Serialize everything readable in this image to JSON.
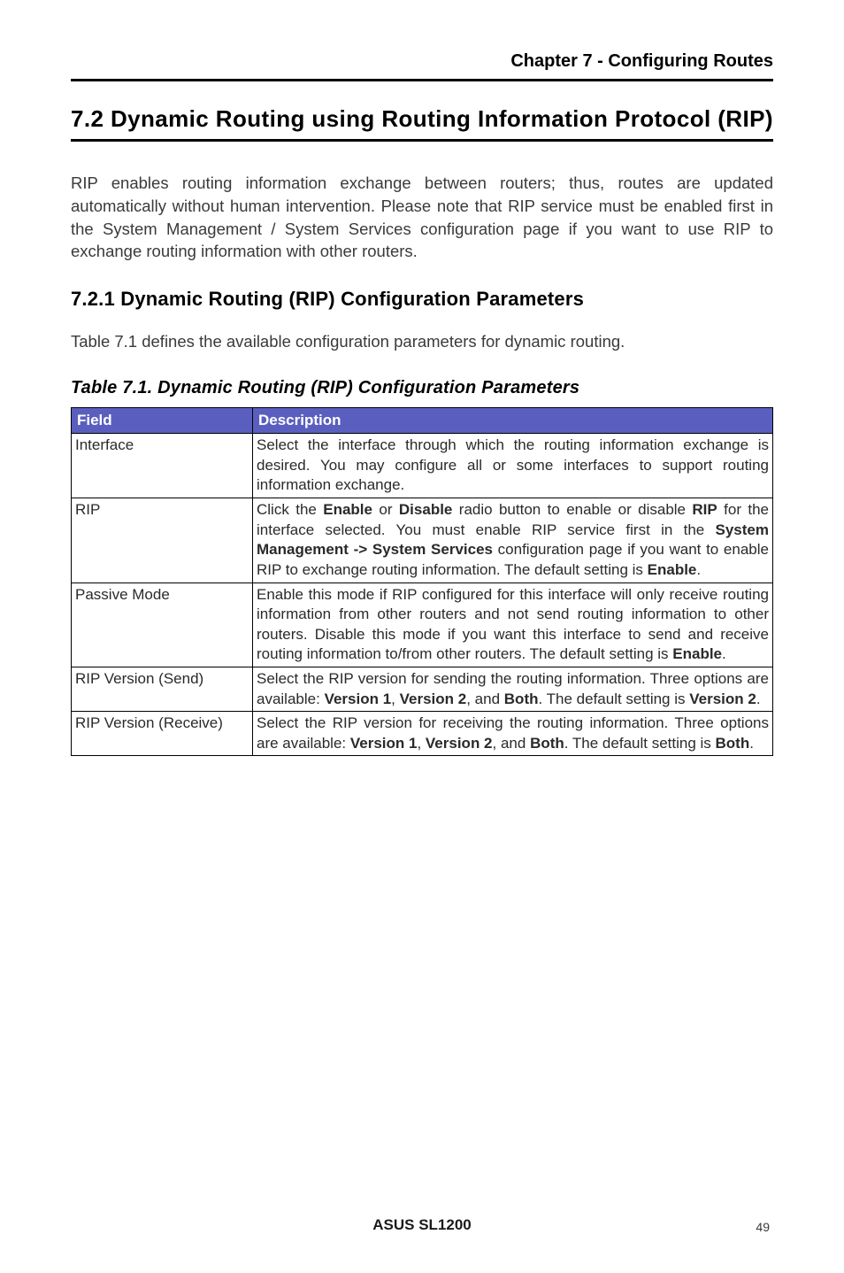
{
  "header": {
    "chapter": "Chapter 7 - Configuring Routes"
  },
  "section": {
    "number_and_title": "7.2 Dynamic Routing using Routing Information Protocol (RIP)"
  },
  "paragraphs": {
    "intro": "RIP enables routing information exchange between routers; thus, routes are updated automatically without human intervention. Please note that RIP service must be enabled first in the System Management / System Services configuration page if you want to use RIP to exchange routing information with other routers.",
    "sub_intro": "Table 7.1 defines the available configuration parameters for dynamic routing."
  },
  "subsection": {
    "title": "7.2.1 Dynamic Routing (RIP) Configuration Parameters"
  },
  "table": {
    "caption": "Table 7.1. Dynamic Routing (RIP) Configuration Parameters",
    "headers": {
      "field": "Field",
      "description": "Description"
    },
    "rows": [
      {
        "field": "Interface",
        "desc_parts": [
          {
            "text": "Select the interface through which the routing information exchange is desired. You may configure all or some interfaces to support routing information exchange."
          }
        ]
      },
      {
        "field": "RIP",
        "desc_parts": [
          {
            "text": "Click the "
          },
          {
            "text": "Enable",
            "bold": true
          },
          {
            "text": " or "
          },
          {
            "text": "Disable",
            "bold": true
          },
          {
            "text": " radio button to enable or disable "
          },
          {
            "text": "RIP",
            "bold": true
          },
          {
            "text": " for the interface selected. You must enable RIP service first in the "
          },
          {
            "text": "System Management -> System Services",
            "bold": true
          },
          {
            "text": " configuration page if you want to enable RIP to exchange routing information. The default setting is "
          },
          {
            "text": "Enable",
            "bold": true
          },
          {
            "text": "."
          }
        ]
      },
      {
        "field": "Passive Mode",
        "desc_parts": [
          {
            "text": "Enable this mode if RIP configured for this interface will only receive routing information from other routers and not send routing information to other routers. Disable this mode if you want this interface to send and receive routing information to/from other routers. The default setting is "
          },
          {
            "text": "Enable",
            "bold": true
          },
          {
            "text": "."
          }
        ]
      },
      {
        "field": "RIP Version (Send)",
        "desc_parts": [
          {
            "text": "Select the RIP version for sending the routing information. Three options are available: "
          },
          {
            "text": "Version 1",
            "bold": true
          },
          {
            "text": ", "
          },
          {
            "text": "Version 2",
            "bold": true
          },
          {
            "text": ", and "
          },
          {
            "text": "Both",
            "bold": true
          },
          {
            "text": ". The default setting is "
          },
          {
            "text": "Version 2",
            "bold": true
          },
          {
            "text": "."
          }
        ]
      },
      {
        "field": "RIP Version (Receive)",
        "desc_parts": [
          {
            "text": "Select the RIP version for receiving the routing information. Three options are available: "
          },
          {
            "text": "Version 1",
            "bold": true
          },
          {
            "text": ", "
          },
          {
            "text": "Version 2",
            "bold": true
          },
          {
            "text": ", and "
          },
          {
            "text": "Both",
            "bold": true
          },
          {
            "text": ". The default setting is "
          },
          {
            "text": "Both",
            "bold": true
          },
          {
            "text": "."
          }
        ]
      }
    ]
  },
  "footer": {
    "product": "ASUS SL1200",
    "page": "49"
  }
}
